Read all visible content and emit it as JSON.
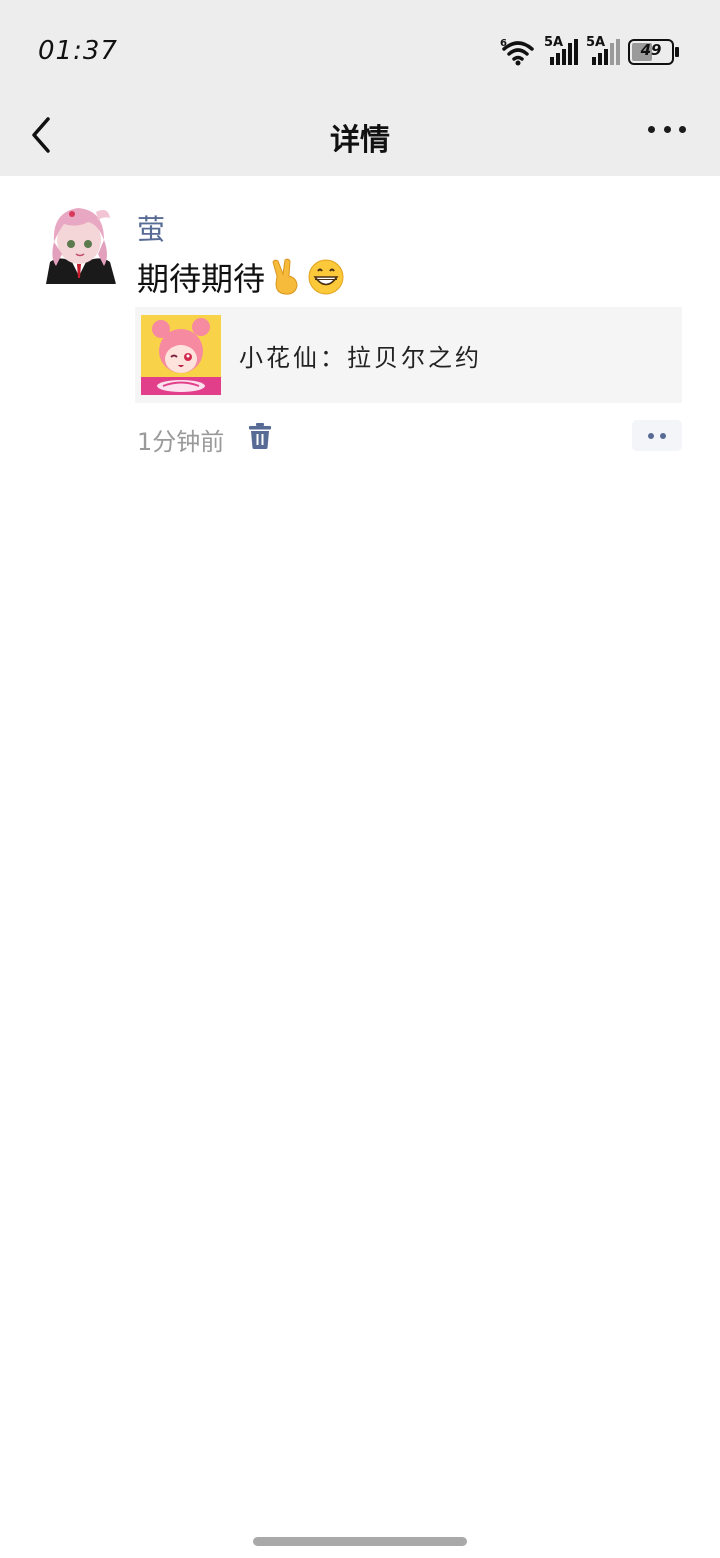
{
  "status_bar": {
    "time": "01:37",
    "network_1": "5A",
    "network_2": "5A",
    "wifi_badge": "6",
    "battery": "49"
  },
  "nav": {
    "title": "详情",
    "back_icon": "chevron-left-icon",
    "more_icon": "ellipsis-icon"
  },
  "post": {
    "username": "萤",
    "text": "期待期待",
    "emojis": [
      "victory-hand-emoji",
      "grinning-face-emoji"
    ],
    "link": {
      "title": "小花仙：拉贝尔之约"
    },
    "time_ago": "1分钟前",
    "delete_icon": "trash-icon",
    "comment_icon": "ellipsis-icon"
  },
  "colors": {
    "bar_bg": "#ededed",
    "username": "#576b95",
    "card_bg": "#f5f5f5",
    "meta": "#9a9a9a"
  }
}
